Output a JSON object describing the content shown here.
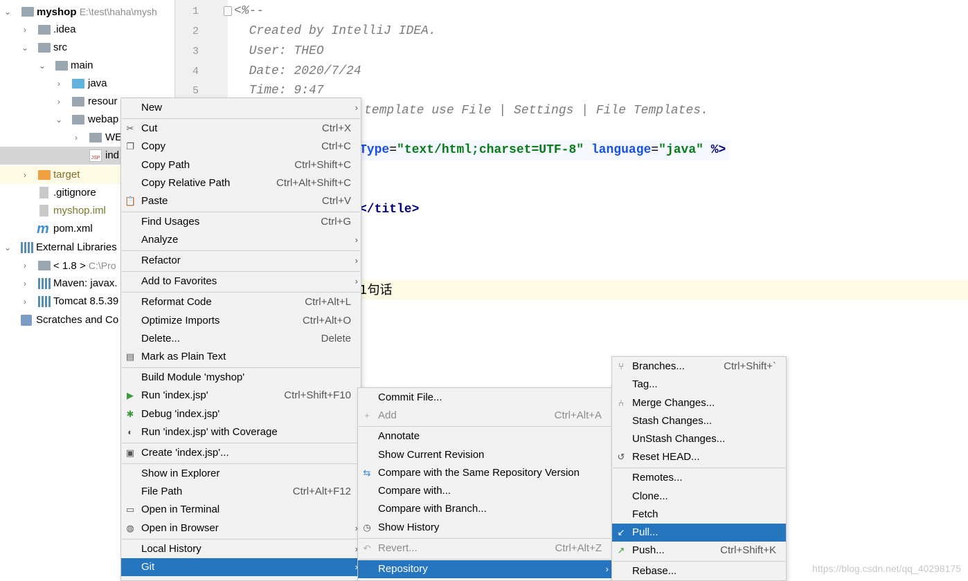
{
  "project_tree": {
    "root": {
      "label": "myshop",
      "path": "E:\\test\\haha\\mysh"
    },
    "items": [
      {
        "label": ".idea"
      },
      {
        "label": "src"
      },
      {
        "label": "main"
      },
      {
        "label": "java"
      },
      {
        "label": "resour"
      },
      {
        "label": "webap"
      },
      {
        "label": "WE"
      },
      {
        "label": "ind"
      },
      {
        "label": "target"
      },
      {
        "label": ".gitignore"
      },
      {
        "label": "myshop.iml"
      },
      {
        "label": "pom.xml"
      },
      {
        "label": "External Libraries"
      },
      {
        "label": "< 1.8 >",
        "path": "C:\\Pro"
      },
      {
        "label": "Maven: javax."
      },
      {
        "label": "Tomcat 8.5.39"
      },
      {
        "label": "Scratches and Co"
      }
    ]
  },
  "editor": {
    "line_numbers": [
      "1",
      "2",
      "3",
      "4",
      "5"
    ],
    "lines": {
      "l1": "<%--",
      "l2": "  Created by IntelliJ IDEA.",
      "l3": "  User: THEO",
      "l4": "  Date: 2020/7/24",
      "l5": "  Time: 9:47",
      "l6": "template use File | Settings | File Templates.",
      "l8_a": "Type",
      "l8_b": "=",
      "l8_c": "\"text/html;charset=UTF-8\"",
      "l8_d": " language",
      "l8_e": "=",
      "l8_f": "\"java\"",
      "l8_g": " %>",
      "l11": "</title>",
      "l15": "1句话"
    }
  },
  "context_menu": {
    "items": [
      {
        "label": "New",
        "shortcut": ""
      },
      {
        "label": "Cut",
        "shortcut": "Ctrl+X",
        "icon": "scissors-icon"
      },
      {
        "label": "Copy",
        "shortcut": "Ctrl+C",
        "icon": "copy-icon"
      },
      {
        "label": "Copy Path",
        "shortcut": "Ctrl+Shift+C"
      },
      {
        "label": "Copy Relative Path",
        "shortcut": "Ctrl+Alt+Shift+C"
      },
      {
        "label": "Paste",
        "shortcut": "Ctrl+V",
        "icon": "clipboard-icon"
      },
      {
        "label": "Find Usages",
        "shortcut": "Ctrl+G"
      },
      {
        "label": "Analyze",
        "shortcut": ""
      },
      {
        "label": "Refactor",
        "shortcut": ""
      },
      {
        "label": "Add to Favorites",
        "shortcut": ""
      },
      {
        "label": "Reformat Code",
        "shortcut": "Ctrl+Alt+L"
      },
      {
        "label": "Optimize Imports",
        "shortcut": "Ctrl+Alt+O"
      },
      {
        "label": "Delete...",
        "shortcut": "Delete"
      },
      {
        "label": "Mark as Plain Text",
        "shortcut": "",
        "icon": "plain-text-icon"
      },
      {
        "label": "Build Module 'myshop'",
        "shortcut": ""
      },
      {
        "label": "Run 'index.jsp'",
        "shortcut": "Ctrl+Shift+F10",
        "icon": "run-icon"
      },
      {
        "label": "Debug 'index.jsp'",
        "shortcut": "",
        "icon": "debug-icon"
      },
      {
        "label": "Run 'index.jsp' with Coverage",
        "shortcut": "",
        "icon": "coverage-icon"
      },
      {
        "label": "Create 'index.jsp'...",
        "shortcut": "",
        "icon": "create-config-icon"
      },
      {
        "label": "Show in Explorer",
        "shortcut": ""
      },
      {
        "label": "File Path",
        "shortcut": "Ctrl+Alt+F12"
      },
      {
        "label": "Open in Terminal",
        "shortcut": "",
        "icon": "terminal-icon"
      },
      {
        "label": "Open in Browser",
        "shortcut": "",
        "icon": "globe-icon"
      },
      {
        "label": "Local History",
        "shortcut": ""
      },
      {
        "label": "Git",
        "shortcut": ""
      }
    ]
  },
  "git_menu": {
    "items": [
      {
        "label": "Commit File...",
        "shortcut": ""
      },
      {
        "label": "Add",
        "shortcut": "Ctrl+Alt+A",
        "icon": "plus-icon"
      },
      {
        "label": "Annotate",
        "shortcut": ""
      },
      {
        "label": "Show Current Revision",
        "shortcut": ""
      },
      {
        "label": "Compare with the Same Repository Version",
        "shortcut": "",
        "icon": "compare-icon"
      },
      {
        "label": "Compare with...",
        "shortcut": ""
      },
      {
        "label": "Compare with Branch...",
        "shortcut": ""
      },
      {
        "label": "Show History",
        "shortcut": "",
        "icon": "clock-icon"
      },
      {
        "label": "Revert...",
        "shortcut": "Ctrl+Alt+Z",
        "icon": "revert-icon"
      },
      {
        "label": "Repository",
        "shortcut": ""
      }
    ]
  },
  "repo_menu": {
    "items": [
      {
        "label": "Branches...",
        "shortcut": "Ctrl+Shift+`",
        "icon": "branch-icon"
      },
      {
        "label": "Tag...",
        "shortcut": ""
      },
      {
        "label": "Merge Changes...",
        "shortcut": "",
        "icon": "merge-icon"
      },
      {
        "label": "Stash Changes...",
        "shortcut": ""
      },
      {
        "label": "UnStash Changes...",
        "shortcut": ""
      },
      {
        "label": "Reset HEAD...",
        "shortcut": "",
        "icon": "reset-icon"
      },
      {
        "label": "Remotes...",
        "shortcut": ""
      },
      {
        "label": "Clone...",
        "shortcut": ""
      },
      {
        "label": "Fetch",
        "shortcut": ""
      },
      {
        "label": "Pull...",
        "shortcut": "",
        "icon": "pull-icon"
      },
      {
        "label": "Push...",
        "shortcut": "Ctrl+Shift+K",
        "icon": "push-icon"
      },
      {
        "label": "Rebase...",
        "shortcut": ""
      }
    ]
  },
  "watermark": "https://blog.csdn.net/qq_40298175",
  "colors": {
    "menu_active": "#2675bf",
    "menu_bg": "#f2f2f2"
  }
}
